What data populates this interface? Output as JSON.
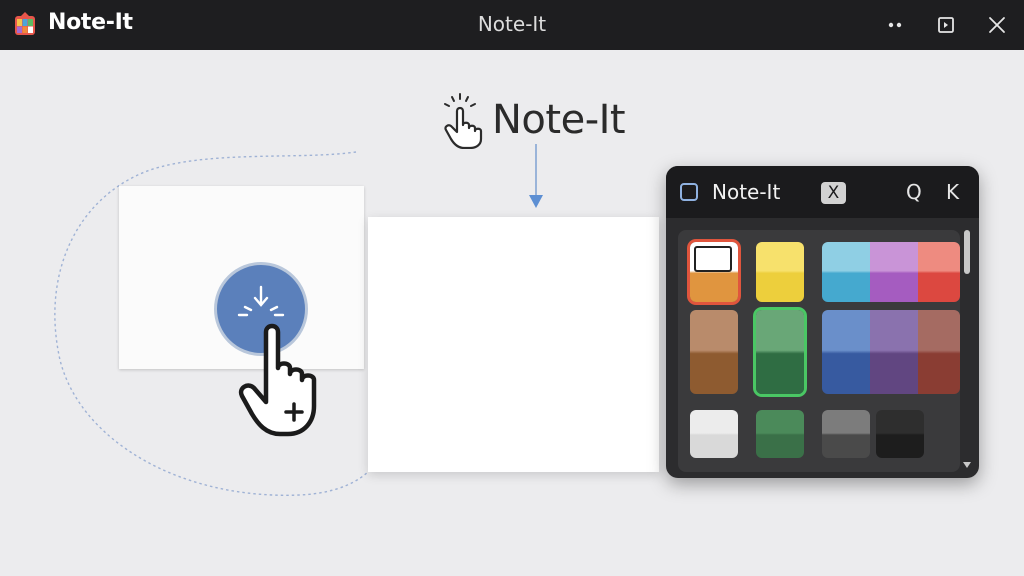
{
  "window": {
    "app_name": "Note-It",
    "title": "Note-It",
    "controls": [
      "more-icon",
      "restore-icon",
      "close-icon"
    ]
  },
  "canvas": {
    "heading": "Note-It",
    "heading_icon": "tap-hand-icon",
    "add_button_icon": "sparkle-icon",
    "cursor_icon": "hand-add-cursor-icon"
  },
  "palette": {
    "title": "Note-It",
    "close_label": "X",
    "search_label": "Q",
    "extra_label": "K",
    "swatches": [
      {
        "name": "white-orange",
        "top": "#ffffff",
        "bottom": "#e0953f",
        "selected": true,
        "selected_color": "#e0553d"
      },
      {
        "name": "yellow",
        "top": "#f7e16c",
        "bottom": "#edcf3c"
      },
      {
        "name": "light-blue",
        "top": "#8fcfe4",
        "bottom": "#45a9cf"
      },
      {
        "name": "purple",
        "top": "#c994d7",
        "bottom": "#a55cc0"
      },
      {
        "name": "red",
        "top": "#ee8b80",
        "bottom": "#dc4840"
      },
      {
        "name": "tan-brown",
        "top": "#b98b6b",
        "bottom": "#8e5b30"
      },
      {
        "name": "green",
        "top": "#69a777",
        "bottom": "#2f6d43",
        "selected": true,
        "selected_color": "#4ac764"
      },
      {
        "name": "steel-blue",
        "top": "#6a8fca",
        "bottom": "#375aa0"
      },
      {
        "name": "violet",
        "top": "#8a72ae",
        "bottom": "#614681"
      },
      {
        "name": "maroon",
        "top": "#a56b62",
        "bottom": "#8a3d33"
      },
      {
        "name": "light-gray",
        "top": "#ececec",
        "bottom": "#d9d9d9"
      },
      {
        "name": "dark-green",
        "top": "#4b8a5a",
        "bottom": "#3a7048"
      },
      {
        "name": "gray",
        "top": "#7c7c7c",
        "bottom": "#4a4a4a"
      },
      {
        "name": "charcoal",
        "top": "#2e2e2e",
        "bottom": "#1d1d1d"
      }
    ]
  }
}
